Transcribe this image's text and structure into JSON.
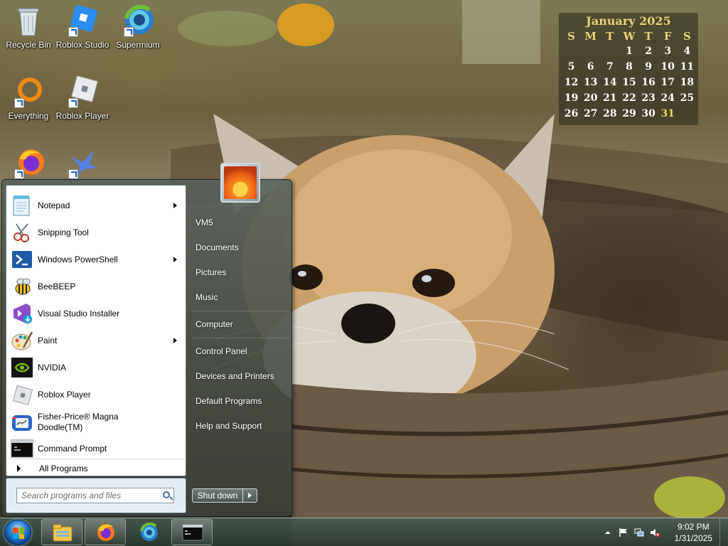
{
  "desktop": {
    "icons": [
      {
        "label": "Recycle Bin",
        "icon": "recycle-bin-icon"
      },
      {
        "label": "Roblox Studio",
        "icon": "roblox-studio-icon"
      },
      {
        "label": "Supermium",
        "icon": "supermium-icon"
      },
      {
        "label": "Everything",
        "icon": "everything-icon"
      },
      {
        "label": "Roblox Player",
        "icon": "roblox-player-icon"
      },
      {
        "label": "",
        "icon": "firefox-icon"
      },
      {
        "label": "",
        "icon": "bird-app-icon"
      }
    ]
  },
  "calendar": {
    "title": "January 2025",
    "weekdays": [
      "S",
      "M",
      "T",
      "W",
      "T",
      "F",
      "S"
    ],
    "weeks": [
      [
        "",
        "",
        "",
        "1",
        "2",
        "3",
        "4"
      ],
      [
        "5",
        "6",
        "7",
        "8",
        "9",
        "10",
        "11"
      ],
      [
        "12",
        "13",
        "14",
        "15",
        "16",
        "17",
        "18"
      ],
      [
        "19",
        "20",
        "21",
        "22",
        "23",
        "24",
        "25"
      ],
      [
        "26",
        "27",
        "28",
        "29",
        "30",
        "31",
        ""
      ]
    ],
    "today": "31",
    "colors": {
      "header": "#e9d27a",
      "today": "#f1d84a"
    }
  },
  "start_menu": {
    "programs": [
      {
        "label": "Notepad",
        "icon": "notepad-icon",
        "has_submenu": true
      },
      {
        "label": "Snipping Tool",
        "icon": "snipping-tool-icon",
        "has_submenu": false
      },
      {
        "label": "Windows PowerShell",
        "icon": "powershell-icon",
        "has_submenu": true
      },
      {
        "label": "BeeBEEP",
        "icon": "beebeep-icon",
        "has_submenu": false
      },
      {
        "label": "Visual Studio Installer",
        "icon": "visual-studio-installer-icon",
        "has_submenu": false
      },
      {
        "label": "Paint",
        "icon": "paint-icon",
        "has_submenu": true
      },
      {
        "label": "NVIDIA",
        "icon": "nvidia-icon",
        "has_submenu": false
      },
      {
        "label": "Roblox Player",
        "icon": "roblox-player-icon",
        "has_submenu": false
      },
      {
        "label": "Fisher-Price® Magna Doodle(TM)",
        "icon": "magna-doodle-icon",
        "has_submenu": false
      },
      {
        "label": "Command Prompt",
        "icon": "command-prompt-icon",
        "has_submenu": false
      }
    ],
    "all_programs": "All Programs",
    "search_placeholder": "Search programs and files",
    "right_links": [
      {
        "label": "VM5"
      },
      {
        "label": "Documents"
      },
      {
        "label": "Pictures"
      },
      {
        "label": "Music"
      },
      {
        "label": "Computer"
      },
      {
        "label": "Control Panel"
      },
      {
        "label": "Devices and Printers"
      },
      {
        "label": "Default Programs"
      },
      {
        "label": "Help and Support"
      }
    ],
    "shutdown_label": "Shut down"
  },
  "taskbar": {
    "pinned": [
      {
        "icon": "windows-explorer-icon",
        "active": true
      },
      {
        "icon": "firefox-icon",
        "active": true
      },
      {
        "icon": "supermium-icon",
        "active": false
      },
      {
        "icon": "command-prompt-icon",
        "active": true
      }
    ],
    "clock_time": "9:02 PM",
    "clock_date": "1/31/2025"
  }
}
